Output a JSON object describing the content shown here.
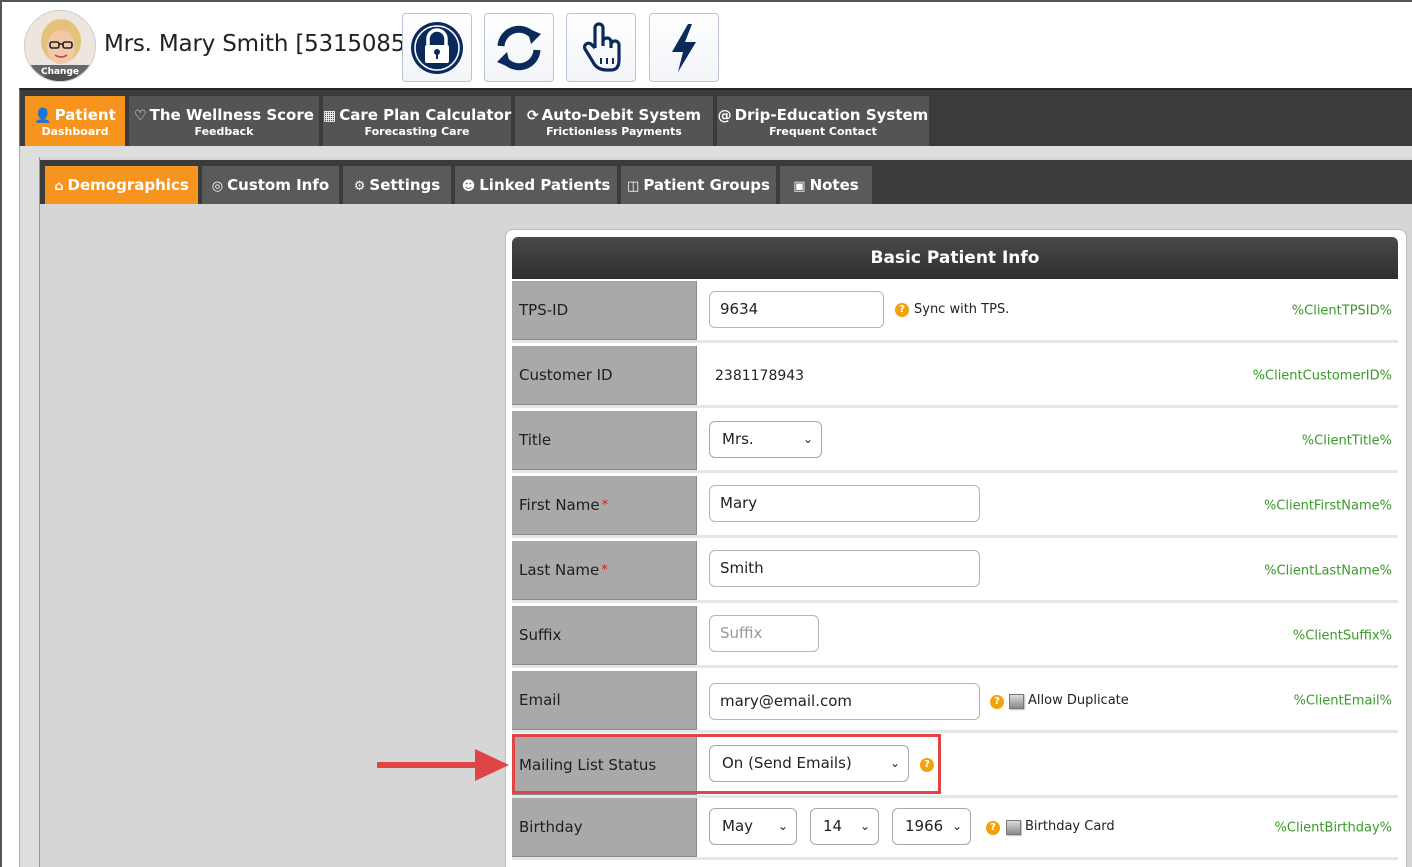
{
  "header": {
    "avatar_change_label": "Change",
    "patient_name": "Mrs. Mary Smith [5315085]",
    "buttons": [
      "lock-icon",
      "refresh-icon",
      "hand-pointer-icon",
      "lightning-icon"
    ]
  },
  "main_nav": {
    "tabs": [
      {
        "label": "Patient",
        "sublabel": "Dashboard",
        "icon": "user-icon",
        "active": true
      },
      {
        "label": "The Wellness Score",
        "sublabel": "Feedback",
        "icon": "heartbeat-icon"
      },
      {
        "label": "Care Plan Calculator",
        "sublabel": "Forecasting Care",
        "icon": "calculator-icon"
      },
      {
        "label": "Auto-Debit System",
        "sublabel": "Frictionless Payments",
        "icon": "refresh-icon"
      },
      {
        "label": "Drip-Education System",
        "sublabel": "Frequent Contact",
        "icon": "at-icon"
      }
    ]
  },
  "sub_nav": {
    "tabs": [
      {
        "label": "Demographics",
        "icon": "home-icon",
        "active": true
      },
      {
        "label": "Custom Info",
        "icon": "bullseye-icon"
      },
      {
        "label": "Settings",
        "icon": "gear-icon"
      },
      {
        "label": "Linked Patients",
        "icon": "users-icon"
      },
      {
        "label": "Patient Groups",
        "icon": "trash-icon"
      },
      {
        "label": "Notes",
        "icon": "note-icon"
      }
    ]
  },
  "panel": {
    "title": "Basic Patient Info",
    "rows": {
      "tps_id": {
        "label": "TPS-ID",
        "value": "9634",
        "help_text": "Sync with TPS.",
        "tag": "%ClientTPSID%"
      },
      "customer_id": {
        "label": "Customer ID",
        "value": "2381178943",
        "tag": "%ClientCustomerID%"
      },
      "title": {
        "label": "Title",
        "value": "Mrs.",
        "tag": "%ClientTitle%"
      },
      "first_name": {
        "label": "First Name",
        "required": "*",
        "value": "Mary",
        "tag": "%ClientFirstName%"
      },
      "last_name": {
        "label": "Last Name",
        "required": "*",
        "value": "Smith",
        "tag": "%ClientLastName%"
      },
      "suffix": {
        "label": "Suffix",
        "placeholder": "Suffix",
        "tag": "%ClientSuffix%"
      },
      "email": {
        "label": "Email",
        "value": "mary@email.com",
        "checkbox_label": "Allow Duplicate",
        "tag": "%ClientEmail%"
      },
      "mailing": {
        "label": "Mailing List Status",
        "value": "On (Send Emails)"
      },
      "birthday": {
        "label": "Birthday",
        "month": "May",
        "day": "14",
        "year": "1966",
        "checkbox_label": "Birthday Card",
        "tag": "%ClientBirthday%"
      }
    }
  },
  "colors": {
    "active_tab": "#f7941d",
    "tag_green": "#3a9a2a",
    "annotation_red": "#e04444",
    "help_orange": "#f0a30a"
  }
}
